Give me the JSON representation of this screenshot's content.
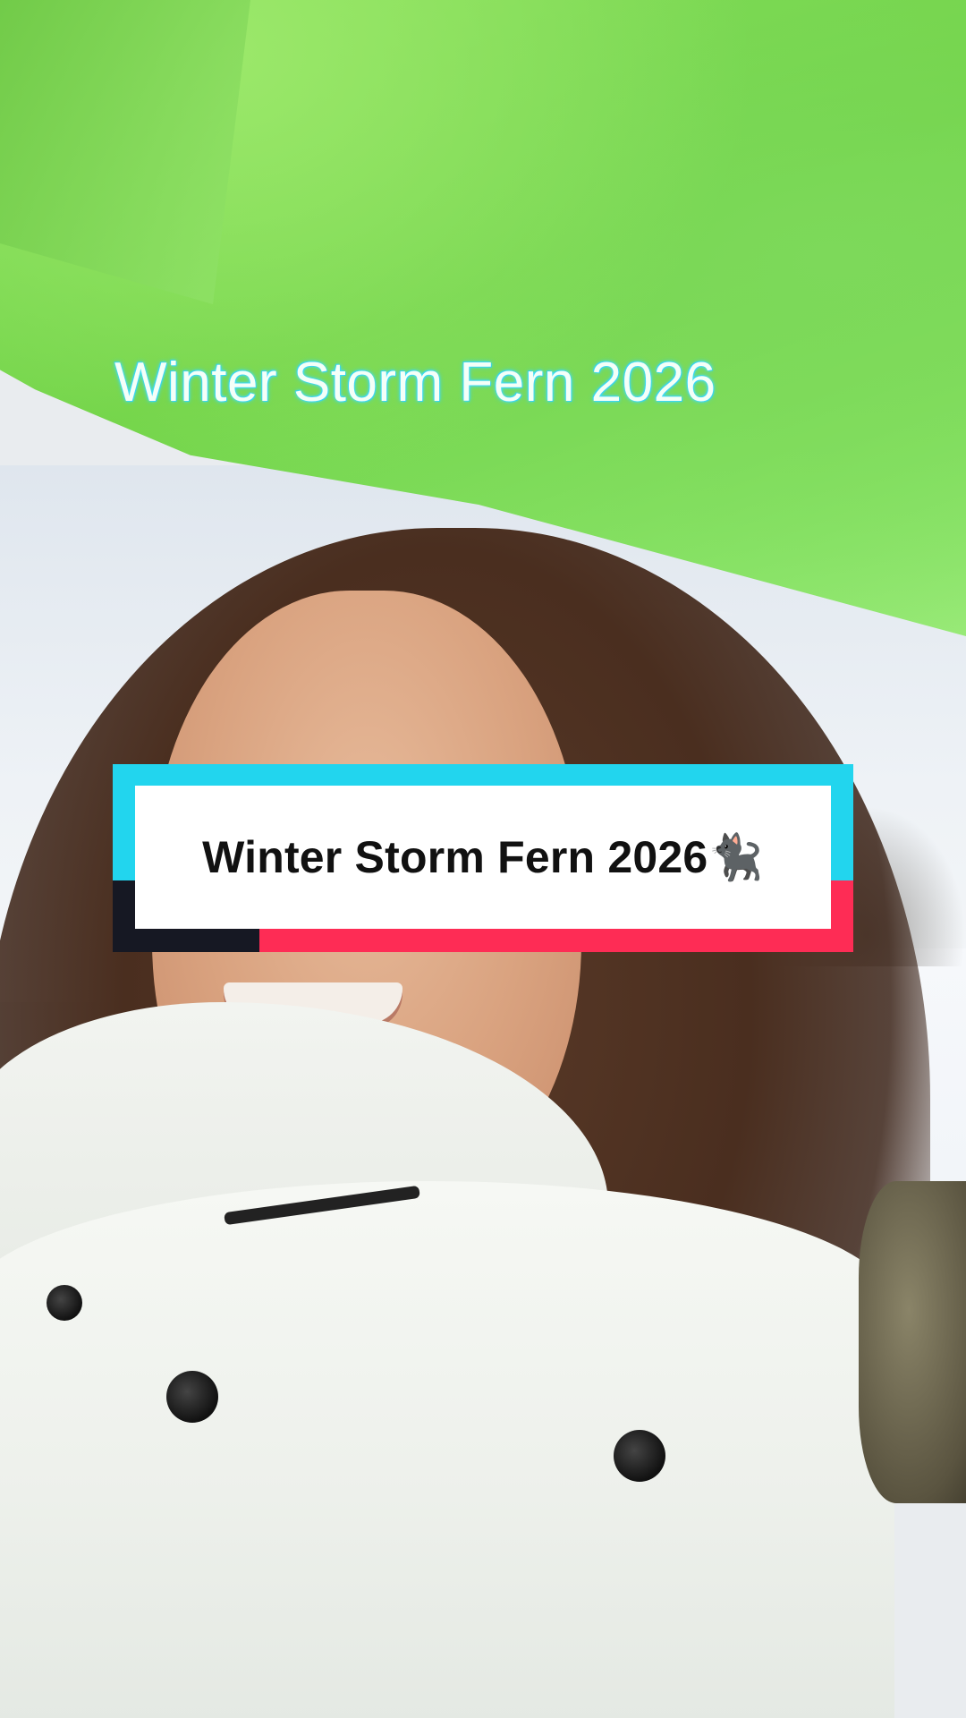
{
  "video": {
    "overlay_title": "Winter Storm Fern 2026",
    "caption": "Winter Storm Fern 2026🐈‍⬛"
  },
  "colors": {
    "caption_cyan": "#22d5ee",
    "caption_pink": "#fe2c55",
    "caption_dark": "#161823",
    "caption_bg": "#ffffff",
    "title_glow": "#4fe6ff"
  }
}
